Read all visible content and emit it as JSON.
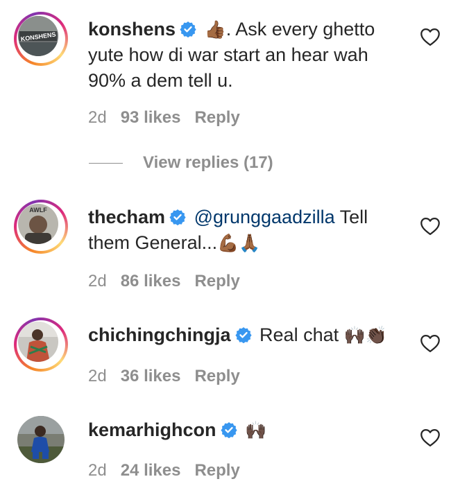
{
  "comments": [
    {
      "username": "konshens",
      "segments": [
        {
          "type": "emoji",
          "text": "👍🏾"
        },
        {
          "type": "text",
          "text": ". Ask every ghetto yute how di war start an hear wah 90% a dem tell u."
        }
      ],
      "time": "2d",
      "likes": "93 likes",
      "reply": "Reply",
      "avatar_text": "KONSHENS",
      "view_replies": "View replies (17)"
    },
    {
      "username": "thecham",
      "segments": [
        {
          "type": "mention",
          "text": "@grunggaadzilla"
        },
        {
          "type": "text",
          "text": " Tell them General..."
        },
        {
          "type": "emoji",
          "text": "💪🏾🙏🏾"
        }
      ],
      "time": "2d",
      "likes": "86 likes",
      "reply": "Reply",
      "avatar_text": "AWLF"
    },
    {
      "username": "chichingchingja",
      "segments": [
        {
          "type": "text",
          "text": "Real chat "
        },
        {
          "type": "emoji",
          "text": "🙌🏿👏🏿"
        }
      ],
      "time": "2d",
      "likes": "36 likes",
      "reply": "Reply"
    },
    {
      "username": "kemarhighcon",
      "segments": [
        {
          "type": "emoji",
          "text": "🙌🏿"
        }
      ],
      "time": "2d",
      "likes": "24 likes",
      "reply": "Reply"
    }
  ],
  "colors": {
    "text": "#262626",
    "meta": "#8e8e8e",
    "verified": "#3897f0",
    "mention": "#00376b"
  },
  "icons": {
    "verified": "verified-badge-icon",
    "heart": "heart-outline-icon"
  }
}
